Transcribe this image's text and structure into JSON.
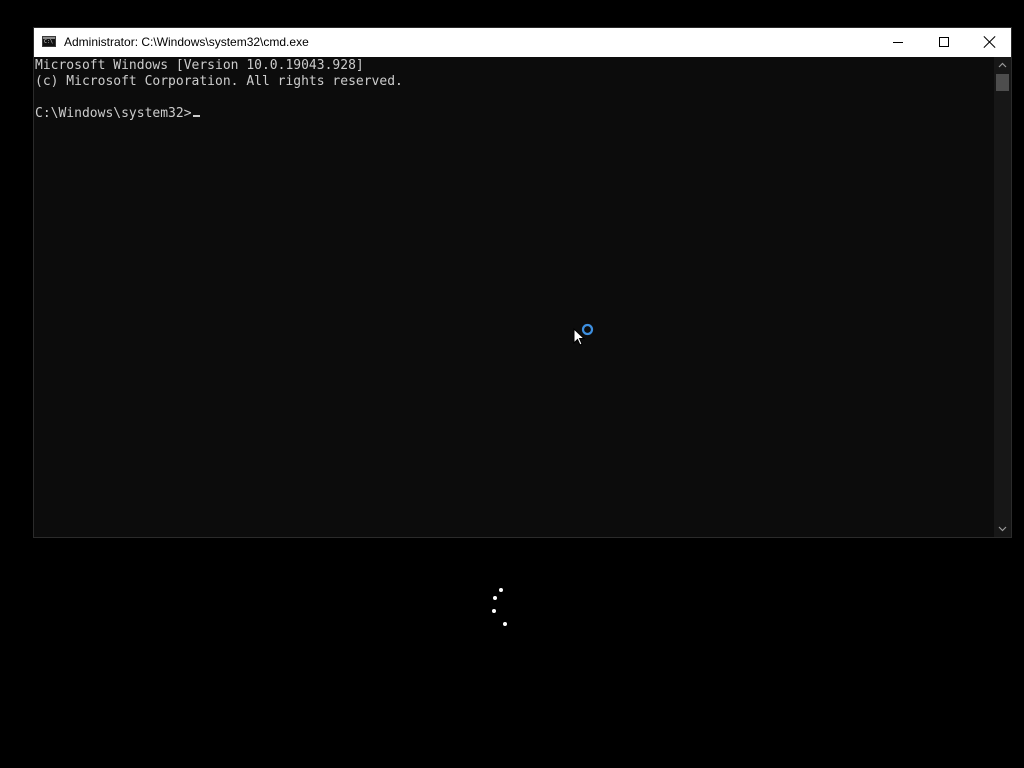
{
  "window": {
    "title": "Administrator: C:\\Windows\\system32\\cmd.exe",
    "icon": "cmd-app-icon",
    "icon_text": "C:\\"
  },
  "caption_buttons": {
    "minimize_icon": "minimize-icon",
    "maximize_icon": "maximize-icon",
    "close_icon": "close-icon"
  },
  "console": {
    "lines": [
      "Microsoft Windows [Version 10.0.19043.928]",
      "(c) Microsoft Corporation. All rights reserved."
    ],
    "prompt": "C:\\Windows\\system32>",
    "foreground_color": "#cccccc",
    "background_color": "#0c0c0c"
  },
  "scrollbar": {
    "up_arrow": "chevron-up-icon",
    "down_arrow": "chevron-down-icon"
  },
  "mouse_pointer": {
    "icon": "busy-cursor-icon",
    "ring_color": "#3d8fe0"
  },
  "loading": {
    "icon": "loading-spinner-icon",
    "dot_color": "#ffffff"
  }
}
